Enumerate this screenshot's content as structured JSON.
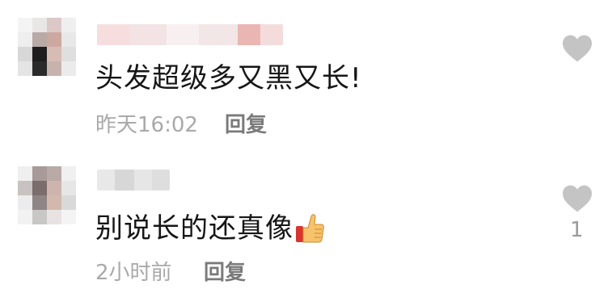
{
  "comments": [
    {
      "text": "头发超级多又黑又长!",
      "time": "昨天16:02",
      "reply": "回复",
      "like_icon": "heart-icon",
      "likes": ""
    },
    {
      "text": "别说长的还真像",
      "emoji": "thumbs-up-icon",
      "time": "2小时前",
      "reply": "回复",
      "like_icon": "heart-icon",
      "likes": "1"
    }
  ],
  "colors": {
    "heart": "#c4c4c4",
    "meta_text": "#a9a9a9",
    "reply_text": "#7a7a7a",
    "comment_text": "#161616"
  }
}
